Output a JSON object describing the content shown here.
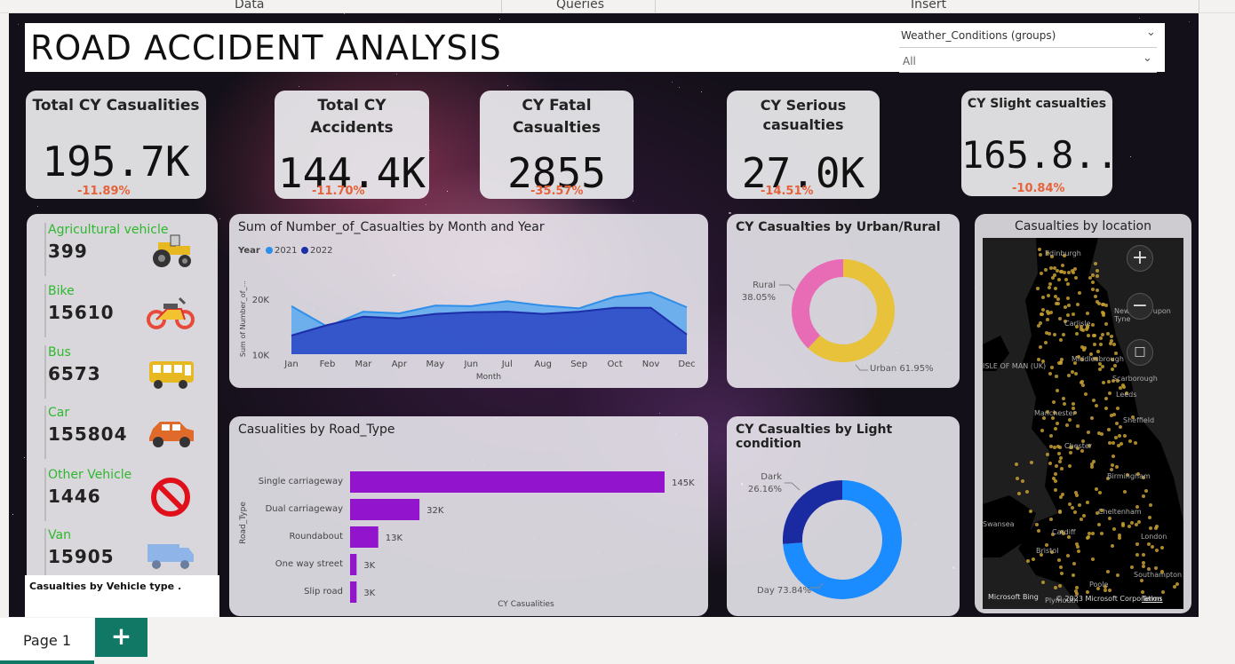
{
  "ribbon": {
    "tabs": [
      "Data",
      "Queries",
      "Insert"
    ]
  },
  "title": "ROAD ACCIDENT ANALYSIS",
  "slicer": {
    "field": "Weather_Conditions (groups)",
    "value": "All"
  },
  "kpis": [
    {
      "title": "Total CY Casualities",
      "value": "195.7K",
      "delta": "-11.89%"
    },
    {
      "title": "Total CY Accidents",
      "value": "144.4K",
      "delta": "-11.70%"
    },
    {
      "title": "CY Fatal Casualties",
      "value": "2855",
      "delta": "-35.57%"
    },
    {
      "title": "CY Serious casualties",
      "value": "27.0K",
      "delta": "-14.51%"
    },
    {
      "title": "CY Slight casualties",
      "value": "165.8...",
      "delta": "-10.84%"
    }
  ],
  "vehicles": {
    "caption": "Casualties by Vehicle type .",
    "items": [
      {
        "name": "Agricultural vehicle",
        "count": "399",
        "icon": "tractor-icon"
      },
      {
        "name": "Bike",
        "count": "15610",
        "icon": "motorbike-icon"
      },
      {
        "name": "Bus",
        "count": "6573",
        "icon": "bus-icon"
      },
      {
        "name": "Car",
        "count": "155804",
        "icon": "car-icon"
      },
      {
        "name": "Other Vehicle",
        "count": "1446",
        "icon": "prohibited-icon"
      },
      {
        "name": "Van",
        "count": "15905",
        "icon": "van-icon"
      }
    ]
  },
  "colors": {
    "series_2021": "#2f8fe8",
    "series_2022": "#1c2ea8",
    "bar": "#9214cc",
    "urban": "#e8c23a",
    "rural": "#e86bb6",
    "day": "#1a8cff",
    "dark": "#1a2aa0",
    "delta": "#e6623a",
    "vehicle_label": "#2db92d"
  },
  "chart_data": [
    {
      "type": "area",
      "title": "Sum of Number_of_Casualties by Month and Year",
      "xlabel": "Month",
      "ylabel": "Sum of Number_of_...",
      "legend_title": "Year",
      "categories": [
        "Jan",
        "Feb",
        "Mar",
        "Apr",
        "May",
        "Jun",
        "Jul",
        "Aug",
        "Sep",
        "Oct",
        "Nov",
        "Dec"
      ],
      "yticks": [
        "10K",
        "20K"
      ],
      "ylim": [
        8000,
        24000
      ],
      "series": [
        {
          "name": "2021",
          "values": [
            18900,
            15200,
            17900,
            17600,
            19000,
            18900,
            19800,
            19000,
            18500,
            20600,
            21400,
            18700
          ]
        },
        {
          "name": "2022",
          "values": [
            13600,
            15500,
            17000,
            16700,
            17500,
            17800,
            17900,
            17500,
            17900,
            18600,
            18600,
            13800
          ]
        }
      ]
    },
    {
      "type": "bar",
      "orientation": "horizontal",
      "title": "Casualities by Road_Type",
      "xlabel": "CY Casualities",
      "ylabel": "Road_Type",
      "categories": [
        "Single carriageway",
        "Dual carriageway",
        "Roundabout",
        "One way street",
        "Slip road"
      ],
      "values": [
        145,
        32,
        13,
        3,
        3
      ],
      "labels": [
        "145K",
        "32K",
        "13K",
        "3K",
        "3K"
      ]
    },
    {
      "type": "pie",
      "title": "CY Casualties by Urban/Rural",
      "slices": [
        {
          "label": "Urban",
          "value": 61.95,
          "text": "Urban 61.95%"
        },
        {
          "label": "Rural",
          "value": 38.05,
          "text": "38.05%"
        }
      ]
    },
    {
      "type": "pie",
      "title": "CY Casualties by Light condition",
      "slices": [
        {
          "label": "Day",
          "value": 73.84,
          "text": "Day 73.84%"
        },
        {
          "label": "Dark",
          "value": 26.16,
          "text": "26.16%"
        }
      ]
    }
  ],
  "map": {
    "title": "Casualties by location",
    "cities": [
      "Edinburgh",
      "Newcastle upon Tyne",
      "Carlisle",
      "Middlesbrough",
      "Scarborough",
      "ISLE OF MAN (UK)",
      "Leeds",
      "Manchester",
      "Sheffield",
      "Chester",
      "Birmingham",
      "Cheltenham",
      "Swansea",
      "Cardiff",
      "Bristol",
      "London",
      "Southampton",
      "Poole",
      "Plymouth"
    ],
    "attribution": "© 2023 Microsoft Corporation",
    "bing": "Microsoft Bing",
    "terms": "Terms"
  },
  "pages": {
    "tab": "Page 1",
    "add": "+"
  }
}
